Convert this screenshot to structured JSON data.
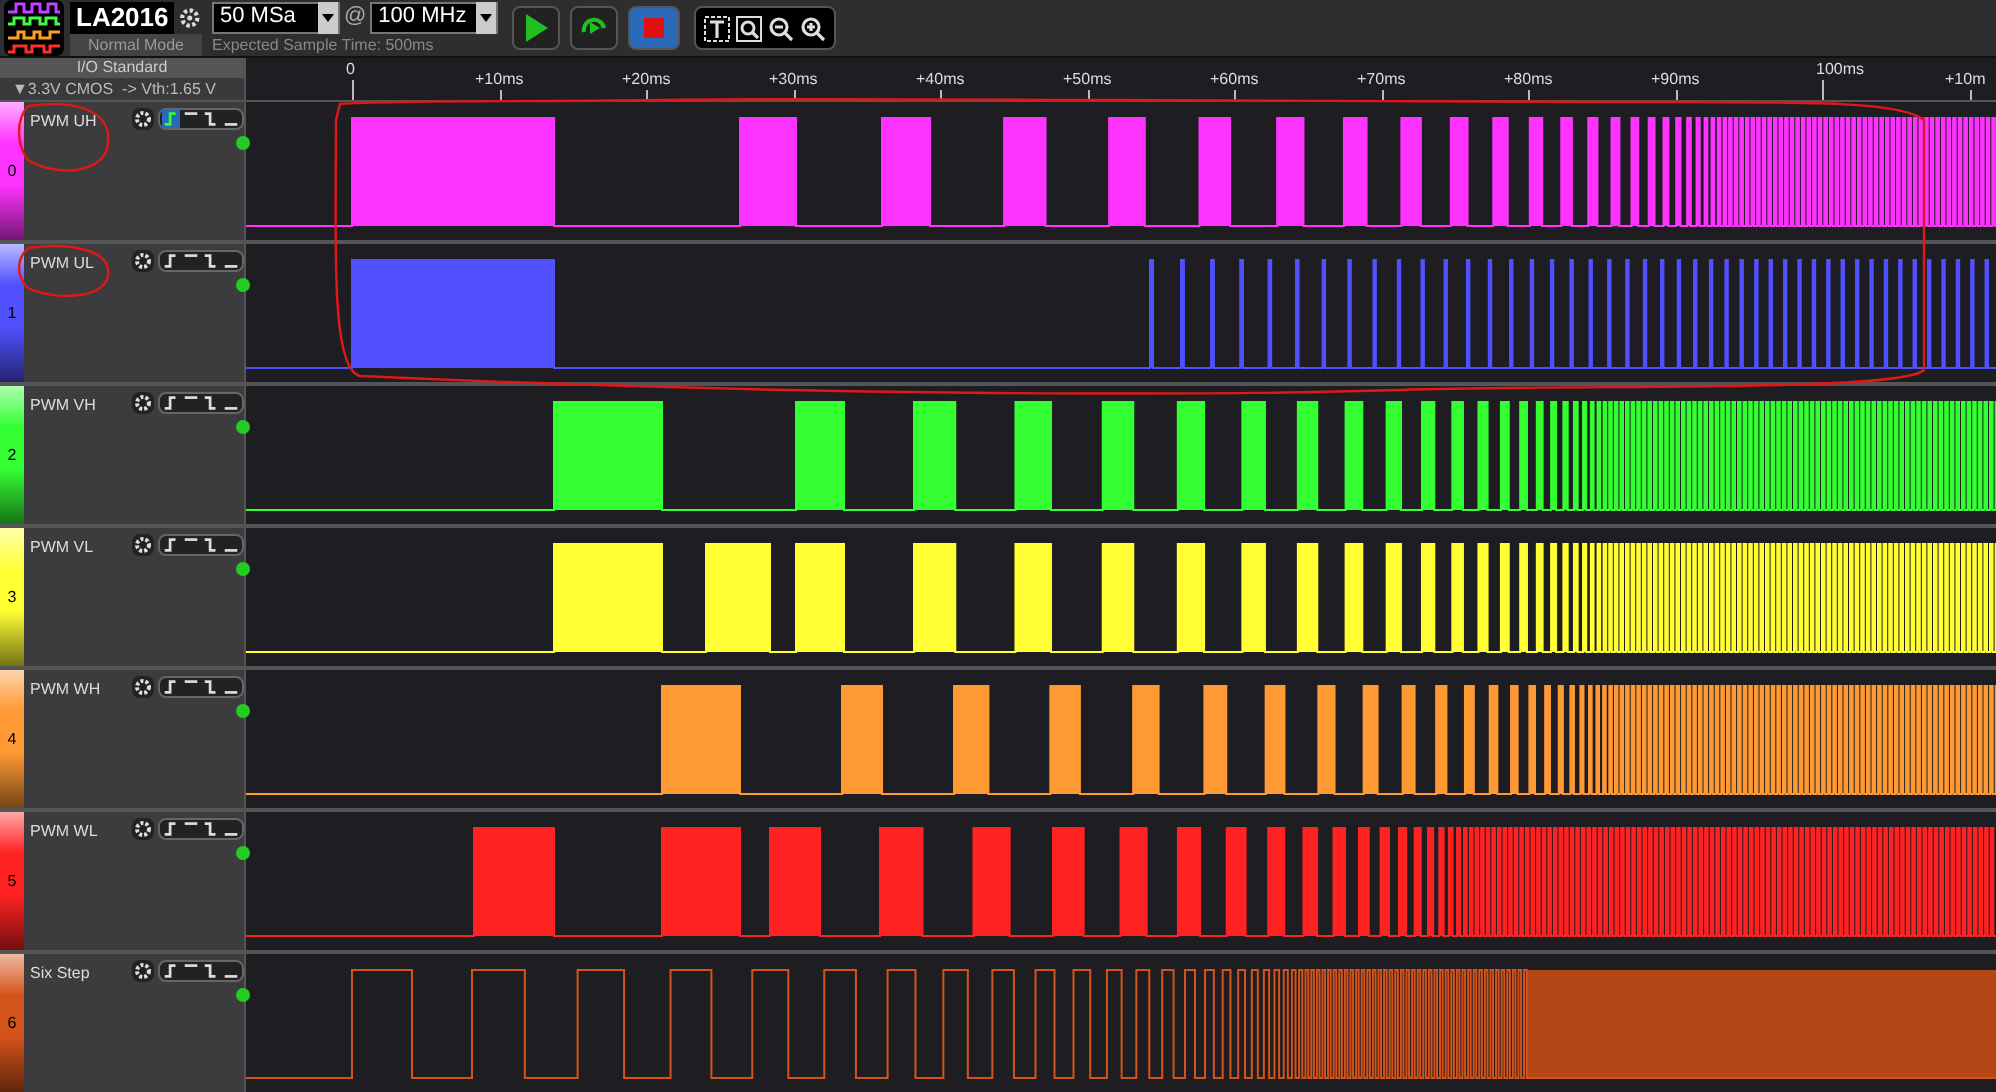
{
  "device": {
    "name": "LA2016",
    "mode": "Normal Mode"
  },
  "sample_depth": {
    "value": "50 MSa"
  },
  "rate_separator": "@",
  "sample_rate": {
    "value": "100 MHz"
  },
  "sample_time": "Expected Sample Time: 500ms",
  "io_standard": {
    "title": "I/O Standard",
    "value": "▼3.3V CMOS  -> Vth:1.65 V"
  },
  "timeline": {
    "ticks": [
      "0",
      "+10ms",
      "+20ms",
      "+30ms",
      "+40ms",
      "+50ms",
      "+60ms",
      "+70ms",
      "+80ms",
      "+90ms",
      "100ms",
      "+10m"
    ]
  },
  "channels": [
    {
      "index": "0",
      "name": "PWM UH",
      "color": "#ff33ff",
      "rising_trigger": true
    },
    {
      "index": "1",
      "name": "PWM UL",
      "color": "#5050ff",
      "rising_trigger": false
    },
    {
      "index": "2",
      "name": "PWM VH",
      "color": "#33ff33",
      "rising_trigger": false
    },
    {
      "index": "3",
      "name": "PWM VL",
      "color": "#ffff33",
      "rising_trigger": false
    },
    {
      "index": "4",
      "name": "PWM WH",
      "color": "#ff9933",
      "rising_trigger": false
    },
    {
      "index": "5",
      "name": "PWM WL",
      "color": "#ff2222",
      "rising_trigger": false
    },
    {
      "index": "6",
      "name": "Six Step",
      "color": "#d4531a",
      "rising_trigger": false
    }
  ]
}
